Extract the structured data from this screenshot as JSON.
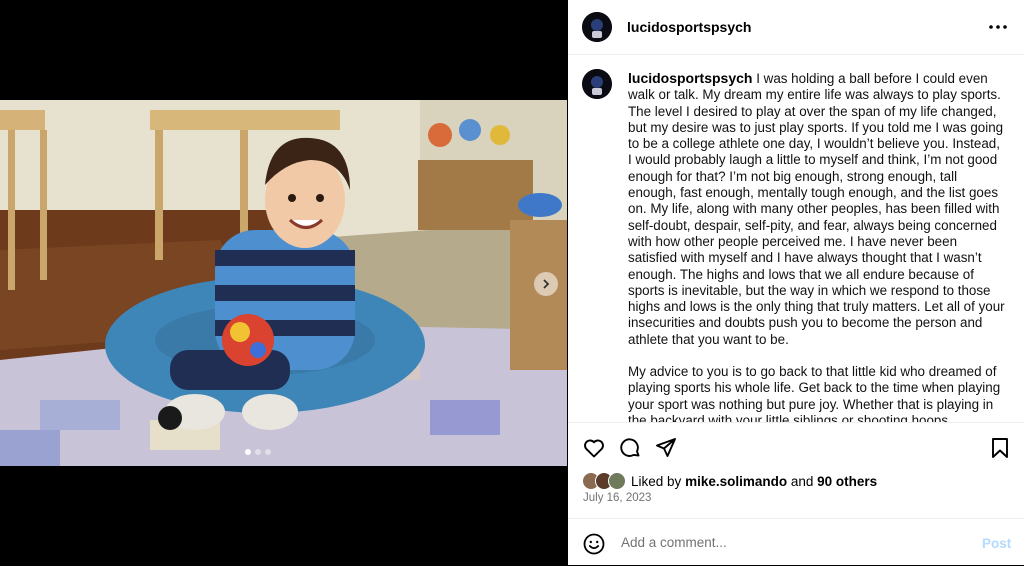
{
  "post": {
    "username": "lucidosportspsych",
    "caption_username": "lucidosportspsych",
    "caption_paragraphs": [
      "I was holding a ball before I could even walk or talk. My dream my entire life was always to play sports. The level I desired to play at over the span of my life changed, but my desire was to just play sports. If you told me I was going to be a college athlete one day, I wouldn’t believe you. Instead, I would probably laugh a little to myself and think, I’m not good enough for that? I’m not big enough, strong enough, tall enough, fast enough, mentally tough enough, and the list goes on. My life, along with many other peoples, has been filled with self-doubt, despair, self-pity, and fear, always being concerned with how other people perceived me. I have never been satisfied with myself and I have always thought that I wasn’t enough. The highs and lows that we all endure because of sports is inevitable, but the way in which we respond to those highs and lows is the only thing that truly matters. Let all of your insecurities and doubts push you to become the person and athlete that you want to be.",
      "My advice to you is to go back to that little kid who dreamed of playing sports his whole life. Get back to the time when playing your sport was nothing but pure joy. Whether that is playing in the backyard with your little siblings or shooting hoops"
    ],
    "likes": {
      "prefix": "Liked by",
      "user": "mike.solimando",
      "conjunction": "and",
      "others": "90 others"
    },
    "date": "July 16, 2023"
  },
  "comment": {
    "placeholder": "Add a comment...",
    "post_label": "Post"
  },
  "carousel": {
    "total": 3,
    "current": 1
  },
  "icons": {
    "more": "more-options-icon",
    "like": "heart-icon",
    "comment": "comment-icon",
    "share": "share-icon",
    "save": "bookmark-icon",
    "emoji": "emoji-icon",
    "next": "chevron-right-icon"
  },
  "colors": {
    "post_button": "#b3dbff",
    "secondary_text": "#737373"
  }
}
